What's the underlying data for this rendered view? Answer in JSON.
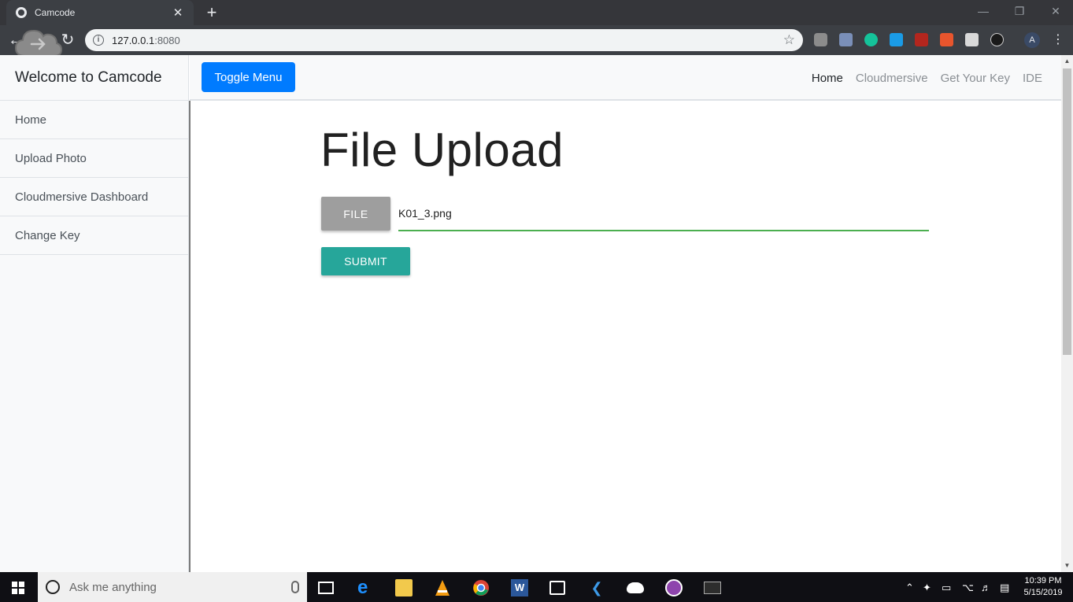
{
  "browser": {
    "tab_title": "Camcode",
    "tab_close": "✕",
    "new_tab": "+",
    "url_host": "127.0.0.1",
    "url_port": ":8080",
    "profile_initial": "A"
  },
  "sidebar": {
    "heading": "Welcome to Camcode",
    "items": [
      {
        "label": "Home"
      },
      {
        "label": "Upload Photo"
      },
      {
        "label": "Cloudmersive Dashboard"
      },
      {
        "label": "Change Key"
      }
    ]
  },
  "topnav": {
    "toggle_label": "Toggle Menu",
    "links": [
      {
        "label": "Home",
        "active": true
      },
      {
        "label": "Cloudmersive"
      },
      {
        "label": "Get Your Key"
      },
      {
        "label": "IDE"
      }
    ]
  },
  "main": {
    "title": "File Upload",
    "file_button_label": "FILE",
    "file_path_value": "K01_3.png",
    "submit_label": "SUBMIT"
  },
  "taskbar": {
    "search_placeholder": "Ask me anything",
    "time": "10:39 PM",
    "date": "5/15/2019"
  },
  "colors": {
    "toggle_button": "#007bff",
    "submit_button": "#26a69a",
    "file_button": "#9e9e9e",
    "input_underline": "#4caf50"
  }
}
